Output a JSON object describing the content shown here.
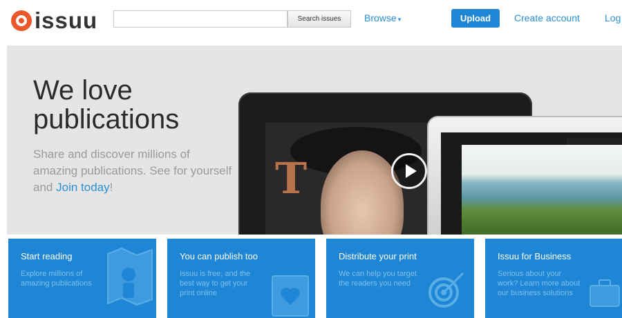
{
  "header": {
    "logo_text": "issuu",
    "search_button_label": "Search issues",
    "browse_label": "Browse",
    "upload_label": "Upload",
    "create_account_label": "Create account",
    "login_label": "Log in"
  },
  "hero": {
    "title_line1": "We love",
    "title_line2": "publications",
    "text": "Share and discover millions of amazing publications. See for yourself and",
    "join_link": "Join today",
    "join_suffix": "!"
  },
  "tiles": [
    {
      "title": "Start reading",
      "desc": "Explore millions of amazing publications",
      "icon": "map-icon"
    },
    {
      "title": "You can publish too",
      "desc": "Issuu is free, and the best way to get your print online",
      "icon": "heart-book-icon"
    },
    {
      "title": "Distribute your print",
      "desc": "We can help you target the readers you need",
      "icon": "target-icon"
    },
    {
      "title": "Issuu for Business",
      "desc": "Serious about your work? Learn more about our business solutions",
      "icon": "briefcase-icon"
    }
  ],
  "colors": {
    "brand_blue": "#1f86d5",
    "link_blue": "#2a8fd5",
    "logo_orange": "#e9572b",
    "hero_bg": "#e5e5e5"
  }
}
